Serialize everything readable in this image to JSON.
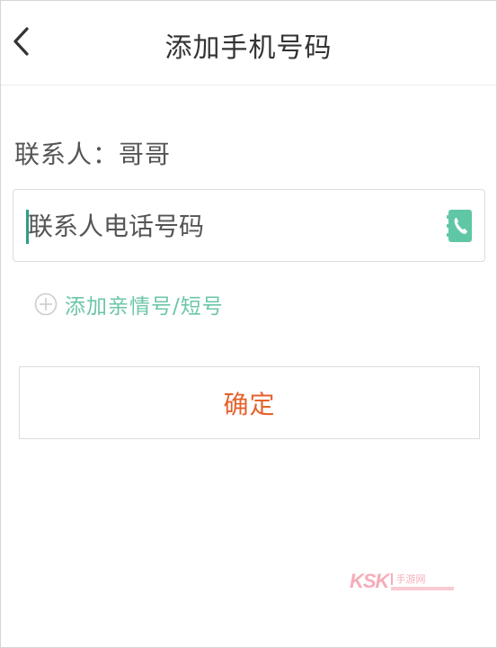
{
  "header": {
    "title": "添加手机号码"
  },
  "contact": {
    "line": "联系人：哥哥"
  },
  "phone_input": {
    "placeholder": "联系人电话号码",
    "value": ""
  },
  "add_family": {
    "label": "添加亲情号/短号"
  },
  "confirm": {
    "label": "确定"
  },
  "watermark": {
    "brand": "KSK",
    "text": "手游网"
  },
  "colors": {
    "accent_green": "#6cc6a8",
    "confirm_orange": "#e4622c",
    "icon_green": "#5fc7a5"
  },
  "icons": {
    "back": "chevron-left-icon",
    "contacts": "phone-book-icon",
    "add": "plus-circle-icon"
  }
}
